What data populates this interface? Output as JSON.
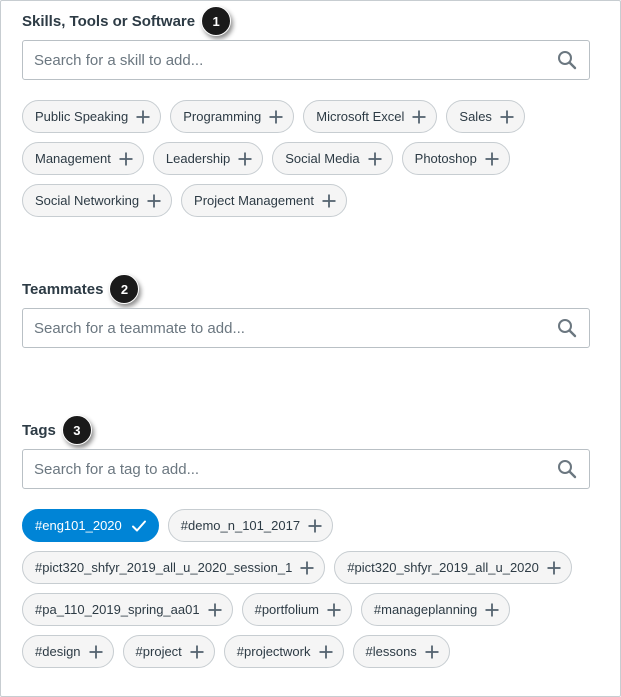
{
  "skills": {
    "title": "Skills, Tools or Software",
    "step": "1",
    "placeholder": "Search for a skill to add...",
    "chips": [
      "Public Speaking",
      "Programming",
      "Microsoft Excel",
      "Sales",
      "Management",
      "Leadership",
      "Social Media",
      "Photoshop",
      "Social Networking",
      "Project Management"
    ]
  },
  "teammates": {
    "title": "Teammates",
    "step": "2",
    "placeholder": "Search for a teammate to add..."
  },
  "tags": {
    "title": "Tags",
    "step": "3",
    "placeholder": "Search for a tag to add...",
    "selected": "#eng101_2020",
    "chips": [
      "#demo_n_101_2017",
      "#pict320_shfyr_2019_all_u_2020_session_1",
      "#pict320_shfyr_2019_all_u_2020",
      "#pa_110_2019_spring_aa01",
      "#portfolium",
      "#manageplanning",
      "#design",
      "#project",
      "#projectwork",
      "#lessons"
    ]
  },
  "colors": {
    "accent": "#0084d6",
    "badge": "#1a1a1a",
    "chip_bg": "#f5f5f5"
  },
  "icons": {
    "search": "magnifier-icon",
    "add": "plus-icon",
    "selected": "checkmark-icon"
  }
}
